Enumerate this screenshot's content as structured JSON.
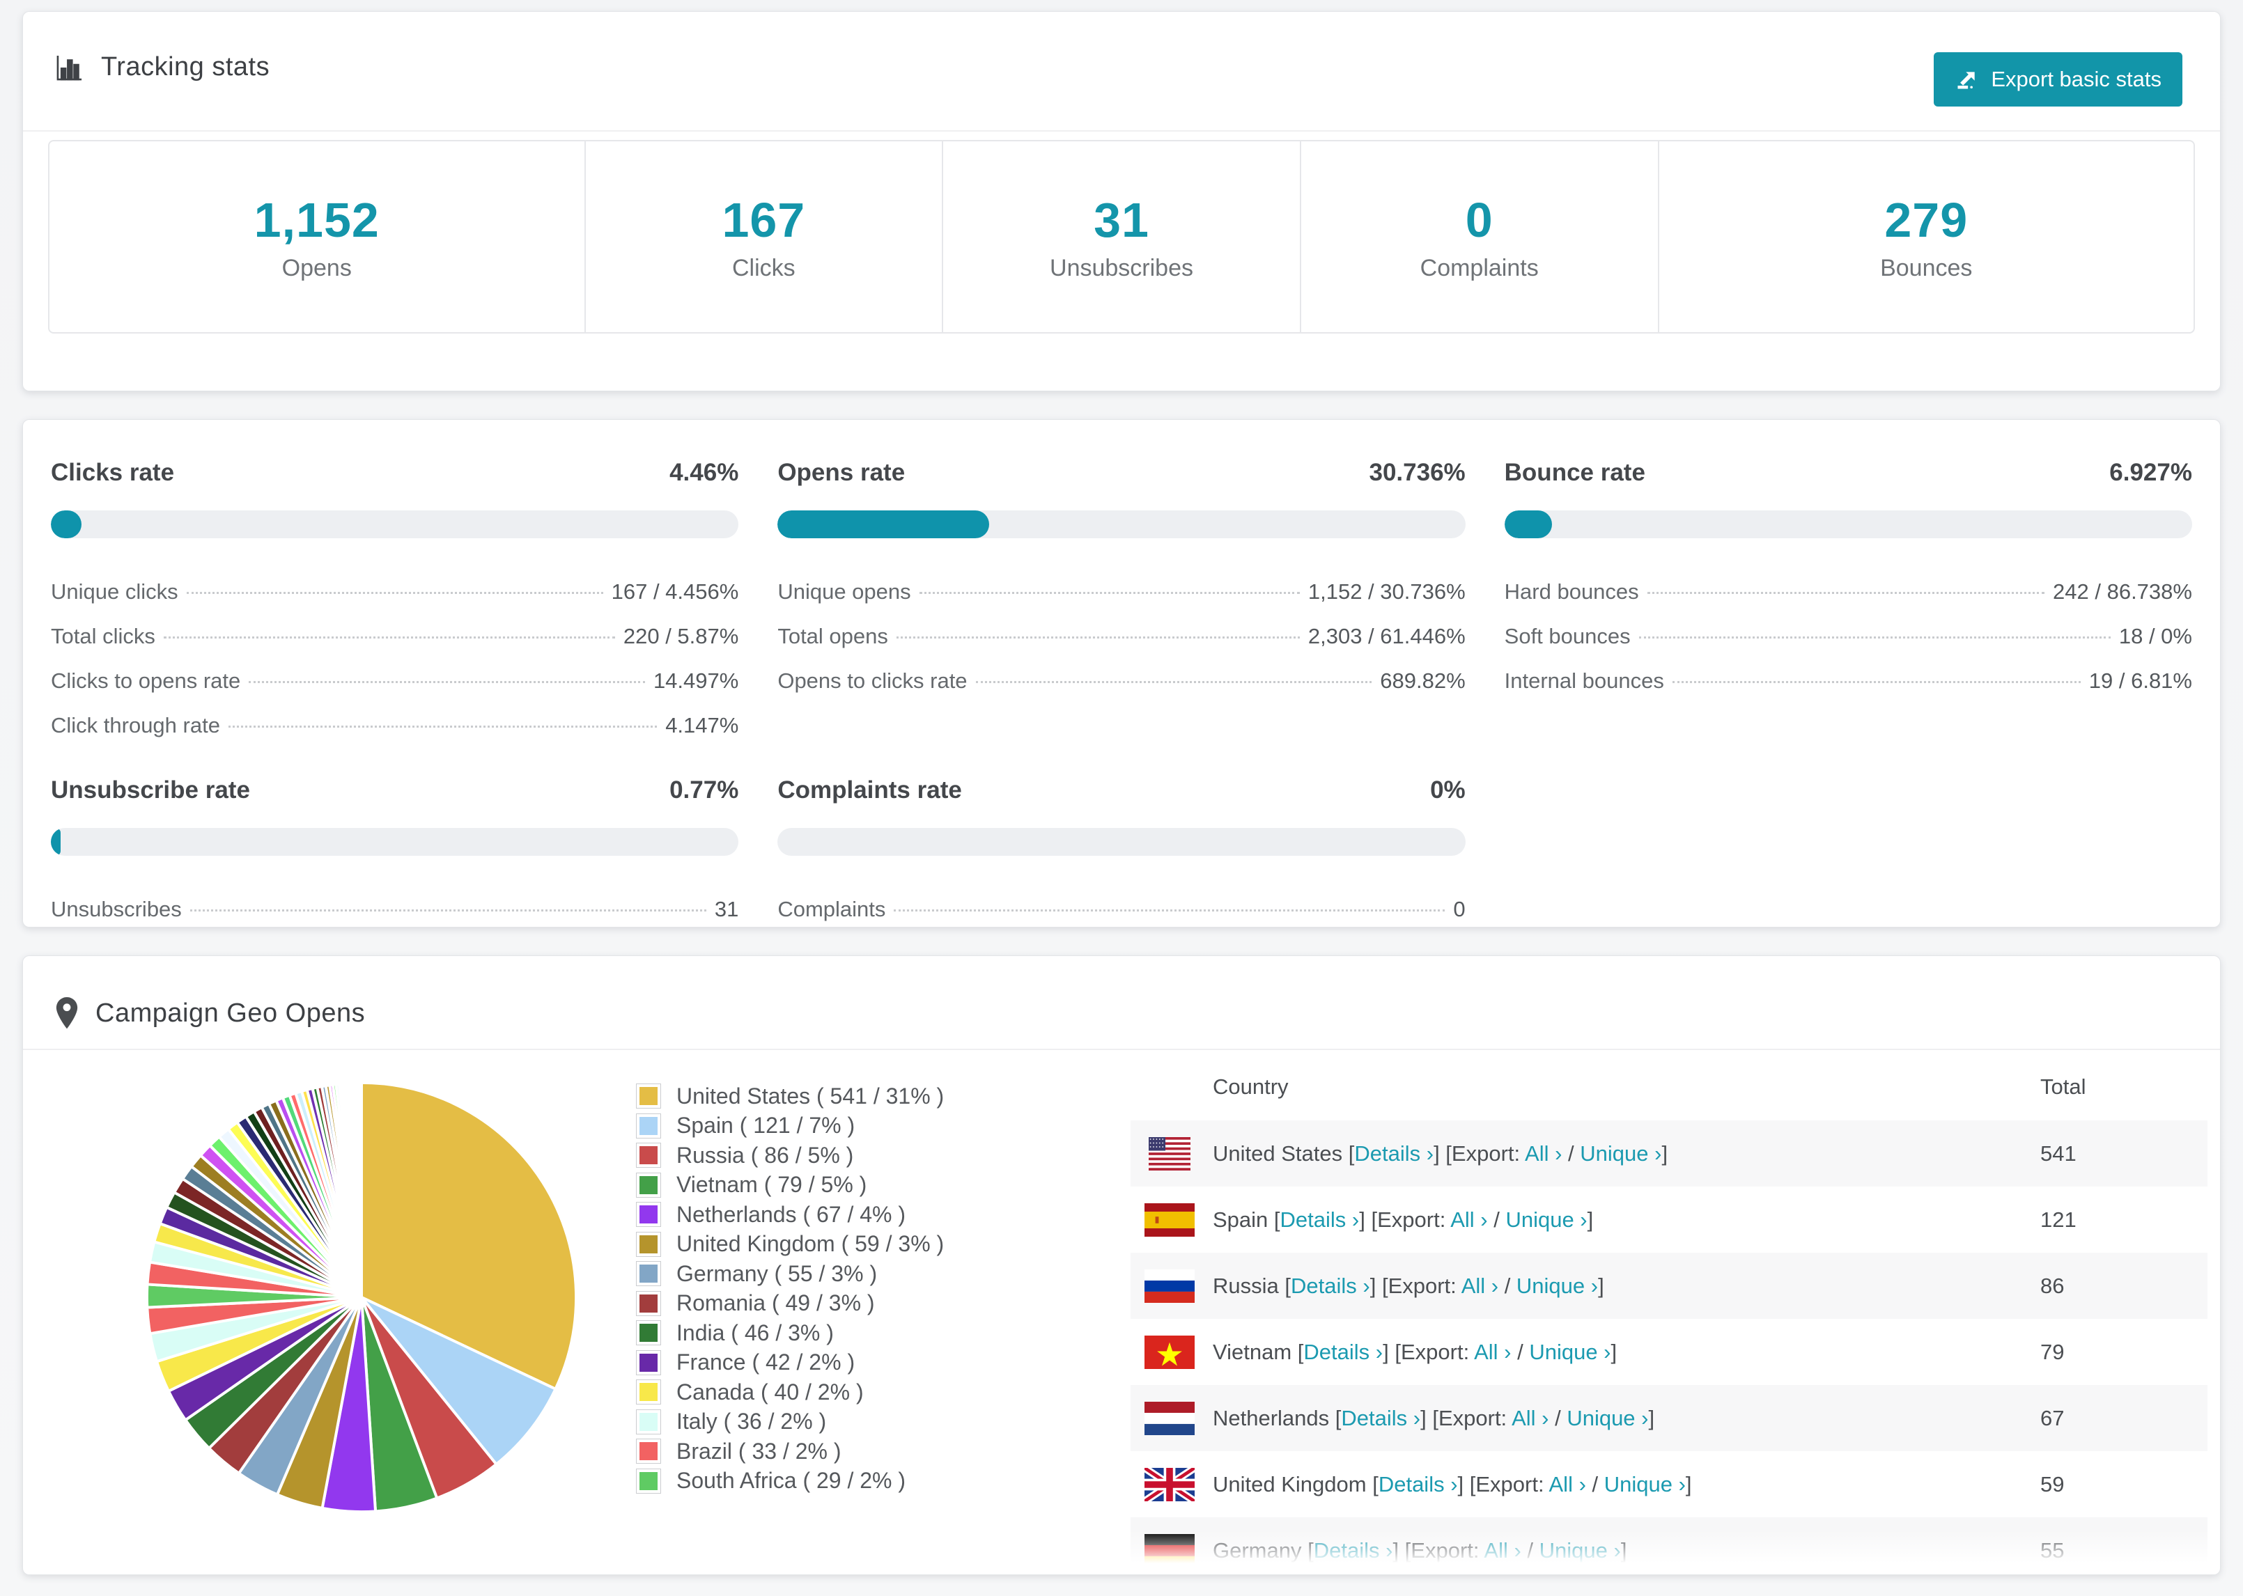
{
  "tracking": {
    "title": "Tracking stats",
    "export_label": "Export basic stats",
    "summary": [
      {
        "value": "1,152",
        "label": "Opens"
      },
      {
        "value": "167",
        "label": "Clicks"
      },
      {
        "value": "31",
        "label": "Unsubscribes"
      },
      {
        "value": "0",
        "label": "Complaints"
      },
      {
        "value": "279",
        "label": "Bounces"
      }
    ]
  },
  "rates": [
    {
      "title": "Clicks rate",
      "value": "4.46%",
      "percent": 4.46,
      "rows": [
        [
          "Unique clicks",
          "167 / 4.456%"
        ],
        [
          "Total clicks",
          "220 / 5.87%"
        ],
        [
          "Clicks to opens rate",
          "14.497%"
        ],
        [
          "Click through rate",
          "4.147%"
        ]
      ]
    },
    {
      "title": "Opens rate",
      "value": "30.736%",
      "percent": 30.736,
      "rows": [
        [
          "Unique opens",
          "1,152 / 30.736%"
        ],
        [
          "Total opens",
          "2,303 / 61.446%"
        ],
        [
          "Opens to clicks rate",
          "689.82%"
        ]
      ]
    },
    {
      "title": "Bounce rate",
      "value": "6.927%",
      "percent": 6.927,
      "rows": [
        [
          "Hard bounces",
          "242 / 86.738%"
        ],
        [
          "Soft bounces",
          "18 / 0%"
        ],
        [
          "Internal bounces",
          "19 / 6.81%"
        ]
      ]
    },
    {
      "title": "Unsubscribe rate",
      "value": "0.77%",
      "percent": 0.77,
      "rows": [
        [
          "Unsubscribes",
          "31"
        ]
      ]
    },
    {
      "title": "Complaints rate",
      "value": "0%",
      "percent": 0,
      "rows": [
        [
          "Complaints",
          "0"
        ]
      ]
    }
  ],
  "geo": {
    "title": "Campaign Geo Opens",
    "chart_data": {
      "type": "pie",
      "title": "Campaign Geo Opens",
      "legend_position": "right",
      "slices": [
        {
          "label": "United States",
          "value": 541,
          "pct": 31,
          "color": "#e4bd45"
        },
        {
          "label": "Spain",
          "value": 121,
          "pct": 7,
          "color": "#abd4f6"
        },
        {
          "label": "Russia",
          "value": 86,
          "pct": 5,
          "color": "#c94b4b"
        },
        {
          "label": "Vietnam",
          "value": 79,
          "pct": 5,
          "color": "#43a048"
        },
        {
          "label": "Netherlands",
          "value": 67,
          "pct": 4,
          "color": "#9238ee"
        },
        {
          "label": "United Kingdom",
          "value": 59,
          "pct": 3,
          "color": "#b5942c"
        },
        {
          "label": "Germany",
          "value": 55,
          "pct": 3,
          "color": "#82a6c6"
        },
        {
          "label": "Romania",
          "value": 49,
          "pct": 3,
          "color": "#a23d3d"
        },
        {
          "label": "India",
          "value": 46,
          "pct": 3,
          "color": "#317b35"
        },
        {
          "label": "France",
          "value": 42,
          "pct": 2,
          "color": "#6829a8"
        },
        {
          "label": "Canada",
          "value": 40,
          "pct": 2,
          "color": "#f8e84a"
        },
        {
          "label": "Italy",
          "value": 36,
          "pct": 2,
          "color": "#d9fdf6"
        },
        {
          "label": "Brazil",
          "value": 33,
          "pct": 2,
          "color": "#f26262"
        },
        {
          "label": "South Africa",
          "value": 29,
          "pct": 2,
          "color": "#5fcb63"
        }
      ],
      "other_slices_estimated": [
        28,
        26,
        24,
        22,
        21,
        20,
        19,
        18,
        17,
        16,
        15,
        14,
        13,
        12,
        11,
        10,
        10,
        9,
        9,
        8,
        8,
        7,
        7,
        6,
        6,
        5,
        5,
        4,
        4,
        4,
        3,
        3,
        3,
        3,
        2,
        2,
        2,
        2,
        2,
        1,
        1,
        1,
        1,
        1,
        1
      ]
    },
    "table": {
      "headers": [
        "Country",
        "Total"
      ],
      "bracket_open": "[",
      "bracket_close": "]",
      "details_label": "Details ›",
      "export_prefix": "[Export:",
      "all_label": "All ›",
      "slash": "/",
      "unique_label": "Unique ›",
      "rows": [
        {
          "country": "United States",
          "flag": "us",
          "total": "541"
        },
        {
          "country": "Spain",
          "flag": "es",
          "total": "121"
        },
        {
          "country": "Russia",
          "flag": "ru",
          "total": "86"
        },
        {
          "country": "Vietnam",
          "flag": "vn",
          "total": "79"
        },
        {
          "country": "Netherlands",
          "flag": "nl",
          "total": "67"
        },
        {
          "country": "United Kingdom",
          "flag": "gb",
          "total": "59"
        },
        {
          "country": "Germany",
          "flag": "de",
          "total": "55"
        }
      ]
    }
  },
  "colors": {
    "accent_teal": "#1295a9",
    "link_teal": "#1b9ab0",
    "stat_number": "#1495aa",
    "bar_track": "#edeff2",
    "row_stripe": "#f7f7f8",
    "others_palette": [
      "#f26262",
      "#d9fdf6",
      "#f7e84b",
      "#5b2aa0",
      "#24531f",
      "#7c2626",
      "#5a7e95",
      "#9d7e22",
      "#cf52f2",
      "#6df06d",
      "#eef7ff",
      "#fdfd55",
      "#2a2a72",
      "#123f16",
      "#6e2020",
      "#4f7487",
      "#8a6d1d",
      "#b94ef0",
      "#52d97a",
      "#ff6b6b",
      "#cdeffc",
      "#ffe14d",
      "#7030b0",
      "#2e7d32",
      "#a03c3c",
      "#7ea4c7",
      "#b8962e",
      "#d44ef2",
      "#7bf07b",
      "#f0f8ff",
      "#ffff66",
      "#3c2a85",
      "#1d4d21",
      "#7a2525",
      "#597e95",
      "#9b7d1f",
      "#e851e8",
      "#a8d4f5",
      "#d84b4b",
      "#49a94d",
      "#9a3bf0",
      "#bb972f",
      "#88a9c9",
      "#aa4040",
      "#35813a"
    ]
  }
}
